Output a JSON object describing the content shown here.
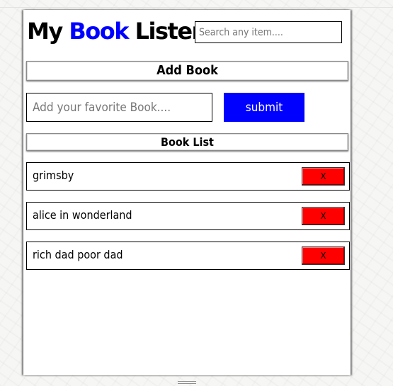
{
  "header": {
    "title_part1": "My ",
    "title_accent": "Book",
    "title_part2": " Lister",
    "search_placeholder": "Search any item...."
  },
  "add_section": {
    "heading": "Add Book",
    "input_placeholder": "Add your favorite Book....",
    "submit_label": "submit"
  },
  "list_section": {
    "heading": "Book List",
    "delete_label": "X",
    "books": [
      "grimsby",
      "alice in wonderland",
      "rich dad poor dad"
    ]
  },
  "colors": {
    "accent": "#0000ff",
    "delete": "#ff0000"
  }
}
